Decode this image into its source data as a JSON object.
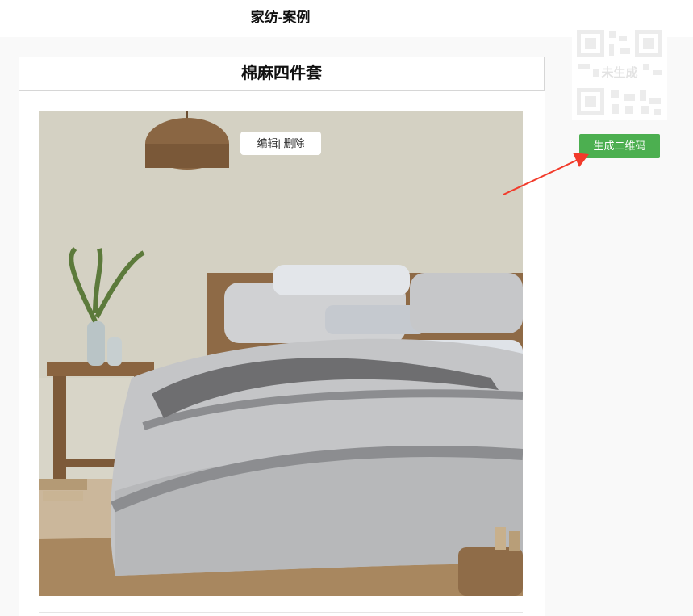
{
  "header": {
    "title": "家纺-案例"
  },
  "card": {
    "title": "棉麻四件套",
    "actions": {
      "edit_label": "编辑",
      "separator": "|",
      "delete_label": "删除"
    },
    "image": {
      "icon": "product-photo"
    }
  },
  "qrcode": {
    "status_label": "未生成",
    "generate_button_label": "生成二维码"
  },
  "colors": {
    "button_green": "#4caf50",
    "annotation_arrow": "#f23b2b"
  }
}
